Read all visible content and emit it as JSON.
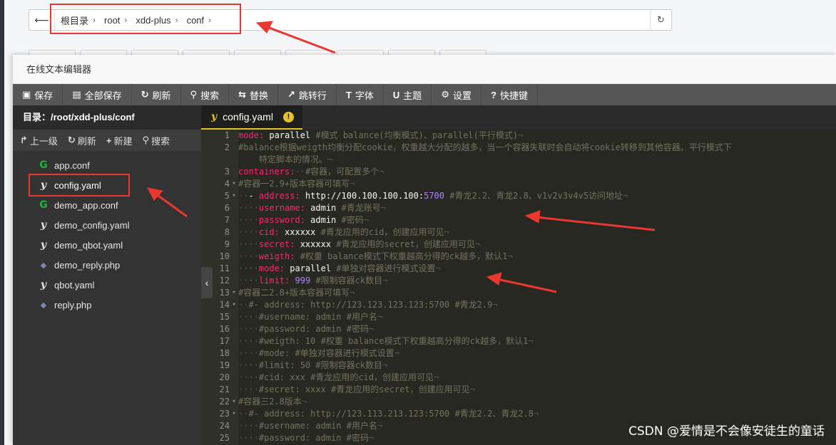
{
  "pathbar": {
    "crumbs": [
      "根目录",
      "root",
      "xdd-plus",
      "conf"
    ]
  },
  "modal": {
    "title": "在线文本编辑器"
  },
  "toolbar": {
    "items": [
      {
        "icon": "save-icon",
        "glyph": "▣",
        "label": "保存"
      },
      {
        "icon": "save-all-icon",
        "glyph": "▤",
        "label": "全部保存"
      },
      {
        "icon": "refresh-icon",
        "glyph": "↻",
        "label": "刷新"
      },
      {
        "icon": "search-icon",
        "glyph": "⚲",
        "label": "搜索"
      },
      {
        "icon": "replace-icon",
        "glyph": "⇆",
        "label": "替换"
      },
      {
        "icon": "goto-line-icon",
        "glyph": "↗",
        "label": "跳转行"
      },
      {
        "icon": "font-icon",
        "glyph": "T",
        "label": "字体"
      },
      {
        "icon": "theme-icon",
        "glyph": "U",
        "label": "主题"
      },
      {
        "icon": "settings-icon",
        "glyph": "⚙",
        "label": "设置"
      },
      {
        "icon": "shortcut-icon",
        "glyph": "?",
        "label": "快捷键"
      }
    ]
  },
  "sidebar": {
    "dir_label": "目录：/root/xdd-plus/conf",
    "tools": [
      {
        "icon": "up-level-icon",
        "glyph": "↱",
        "label": "上一级"
      },
      {
        "icon": "refresh-icon",
        "glyph": "↻",
        "label": "刷新"
      },
      {
        "icon": "new-icon",
        "glyph": "+",
        "label": "新建"
      },
      {
        "icon": "search-icon",
        "glyph": "⚲",
        "label": "搜索"
      }
    ],
    "files": [
      {
        "name": "app.conf",
        "type": "conf",
        "glyph": "G"
      },
      {
        "name": "config.yaml",
        "type": "yaml",
        "glyph": "y"
      },
      {
        "name": "demo_app.conf",
        "type": "conf",
        "glyph": "G"
      },
      {
        "name": "demo_config.yaml",
        "type": "yaml",
        "glyph": "y"
      },
      {
        "name": "demo_qbot.yaml",
        "type": "yaml",
        "glyph": "y"
      },
      {
        "name": "demo_reply.php",
        "type": "php",
        "glyph": "◆"
      },
      {
        "name": "qbot.yaml",
        "type": "yaml",
        "glyph": "y"
      },
      {
        "name": "reply.php",
        "type": "php",
        "glyph": "◆"
      }
    ]
  },
  "editor": {
    "tab_label": "config.yaml",
    "warn_glyph": "!",
    "lines": [
      {
        "num": "1",
        "fold": "",
        "segs": [
          [
            "k",
            "mode:"
          ],
          [
            "v",
            " parallel "
          ],
          [
            "c",
            "#模式 balance(均衡模式)、parallel(平行模式)"
          ],
          [
            "w",
            "¬"
          ]
        ]
      },
      {
        "num": "2",
        "fold": "",
        "segs": [
          [
            "c",
            "#balance根据weigth均衡分配cookie，权重越大分配的越多，当一个容器失联时会自动将cookie转移到其他容器。平行模式下"
          ]
        ]
      },
      {
        "num": "",
        "fold": "",
        "segs": [
          [
            "c",
            "    特定脚本的情况。"
          ],
          [
            "w",
            "¬"
          ]
        ]
      },
      {
        "num": "3",
        "fold": "",
        "segs": [
          [
            "k",
            "containers:"
          ],
          [
            "w",
            "··"
          ],
          [
            "c",
            "#容器，可配置多个"
          ],
          [
            "w",
            "¬"
          ]
        ]
      },
      {
        "num": "4",
        "fold": "▾",
        "segs": [
          [
            "c",
            "#容器一2.9+版本容器可填写"
          ],
          [
            "w",
            "¬"
          ]
        ]
      },
      {
        "num": "5",
        "fold": "▾",
        "segs": [
          [
            "w",
            "··"
          ],
          [
            "v",
            "- "
          ],
          [
            "k",
            "address:"
          ],
          [
            "v",
            " http://100.100.100.100:"
          ],
          [
            "n",
            "5700"
          ],
          [
            "c",
            " #青龙2.2、青龙2.8、v1v2v3v4v5访问地址"
          ],
          [
            "w",
            "¬"
          ]
        ]
      },
      {
        "num": "6",
        "fold": "",
        "segs": [
          [
            "w",
            "····"
          ],
          [
            "k",
            "username:"
          ],
          [
            "v",
            " admin "
          ],
          [
            "c",
            "#青龙账号"
          ],
          [
            "w",
            "¬"
          ]
        ]
      },
      {
        "num": "7",
        "fold": "",
        "segs": [
          [
            "w",
            "····"
          ],
          [
            "k",
            "password:"
          ],
          [
            "v",
            " admin "
          ],
          [
            "c",
            "#密码"
          ],
          [
            "w",
            "¬"
          ]
        ]
      },
      {
        "num": "8",
        "fold": "",
        "segs": [
          [
            "w",
            "····"
          ],
          [
            "k",
            "cid:"
          ],
          [
            "v",
            " xxxxxx "
          ],
          [
            "c",
            "#青龙应用的cid，创建应用可见"
          ],
          [
            "w",
            "¬"
          ]
        ]
      },
      {
        "num": "9",
        "fold": "",
        "segs": [
          [
            "w",
            "····"
          ],
          [
            "k",
            "secret:"
          ],
          [
            "v",
            " xxxxxx "
          ],
          [
            "c",
            "#青龙应用的secret，创建应用可见"
          ],
          [
            "w",
            "¬"
          ]
        ]
      },
      {
        "num": "10",
        "fold": "",
        "segs": [
          [
            "w",
            "····"
          ],
          [
            "k",
            "weigth:"
          ],
          [
            "c",
            " #权重 balance模式下权重越高分得的ck越多，默认1"
          ],
          [
            "w",
            "¬"
          ]
        ]
      },
      {
        "num": "11",
        "fold": "",
        "segs": [
          [
            "w",
            "····"
          ],
          [
            "k",
            "mode:"
          ],
          [
            "v",
            " parallel "
          ],
          [
            "c",
            "#单独对容器进行模式设置"
          ],
          [
            "w",
            "¬"
          ]
        ]
      },
      {
        "num": "12",
        "fold": "",
        "segs": [
          [
            "w",
            "····"
          ],
          [
            "k",
            "limit:"
          ],
          [
            "n",
            " 999 "
          ],
          [
            "c",
            "#限制容器ck数目"
          ],
          [
            "w",
            "¬"
          ]
        ]
      },
      {
        "num": "13",
        "fold": "▾",
        "segs": [
          [
            "c",
            "#容器二2.8+版本容器可填写"
          ],
          [
            "w",
            "¬"
          ]
        ]
      },
      {
        "num": "14",
        "fold": "▾",
        "segs": [
          [
            "w",
            "··"
          ],
          [
            "c",
            "#- address: http://123.123.123.123:5700 #青龙2.9"
          ],
          [
            "w",
            "¬"
          ]
        ]
      },
      {
        "num": "15",
        "fold": "",
        "segs": [
          [
            "w",
            "····"
          ],
          [
            "c",
            "#username: admin #用户名"
          ],
          [
            "w",
            "¬"
          ]
        ]
      },
      {
        "num": "16",
        "fold": "",
        "segs": [
          [
            "w",
            "····"
          ],
          [
            "c",
            "#password: admin #密码"
          ],
          [
            "w",
            "¬"
          ]
        ]
      },
      {
        "num": "17",
        "fold": "",
        "segs": [
          [
            "w",
            "····"
          ],
          [
            "c",
            "#weigth: 10 #权重 balance模式下权重越高分得的ck越多，默认1"
          ],
          [
            "w",
            "¬"
          ]
        ]
      },
      {
        "num": "18",
        "fold": "",
        "segs": [
          [
            "w",
            "····"
          ],
          [
            "c",
            "#mode: #单独对容器进行模式设置"
          ],
          [
            "w",
            "¬"
          ]
        ]
      },
      {
        "num": "19",
        "fold": "",
        "segs": [
          [
            "w",
            "····"
          ],
          [
            "c",
            "#limit: 50 #限制容器ck数目"
          ],
          [
            "w",
            "¬"
          ]
        ]
      },
      {
        "num": "20",
        "fold": "",
        "segs": [
          [
            "w",
            "····"
          ],
          [
            "c",
            "#cid: xxx #青龙应用的cid，创建应用可见"
          ],
          [
            "w",
            "¬"
          ]
        ]
      },
      {
        "num": "21",
        "fold": "",
        "segs": [
          [
            "w",
            "····"
          ],
          [
            "c",
            "#secret: xxxx #青龙应用的secret，创建应用可见"
          ],
          [
            "w",
            "¬"
          ]
        ]
      },
      {
        "num": "22",
        "fold": "▾",
        "segs": [
          [
            "c",
            "#容器三2.8版本"
          ],
          [
            "w",
            "¬"
          ]
        ]
      },
      {
        "num": "23",
        "fold": "▾",
        "segs": [
          [
            "w",
            "··"
          ],
          [
            "c",
            "#- address: http://123.113.213.123:5700 #青龙2.2、青龙2.8"
          ],
          [
            "w",
            "¬"
          ]
        ]
      },
      {
        "num": "24",
        "fold": "",
        "segs": [
          [
            "w",
            "····"
          ],
          [
            "c",
            "#username: admin #用户名"
          ],
          [
            "w",
            "¬"
          ]
        ]
      },
      {
        "num": "25",
        "fold": "",
        "segs": [
          [
            "w",
            "····"
          ],
          [
            "c",
            "#password: admin #密码"
          ],
          [
            "w",
            "¬"
          ]
        ]
      }
    ]
  },
  "watermark": "CSDN @爱情是不会像安徒生的童话",
  "colors": {
    "annotation": "#e8382f",
    "toolbar_bg": "#565656",
    "editor_bg": "#272822",
    "sidebar_bg": "#333333",
    "yaml_key": "#f92672",
    "comment": "#75715e",
    "number": "#ae81ff",
    "tab_accent": "#e6c229"
  }
}
